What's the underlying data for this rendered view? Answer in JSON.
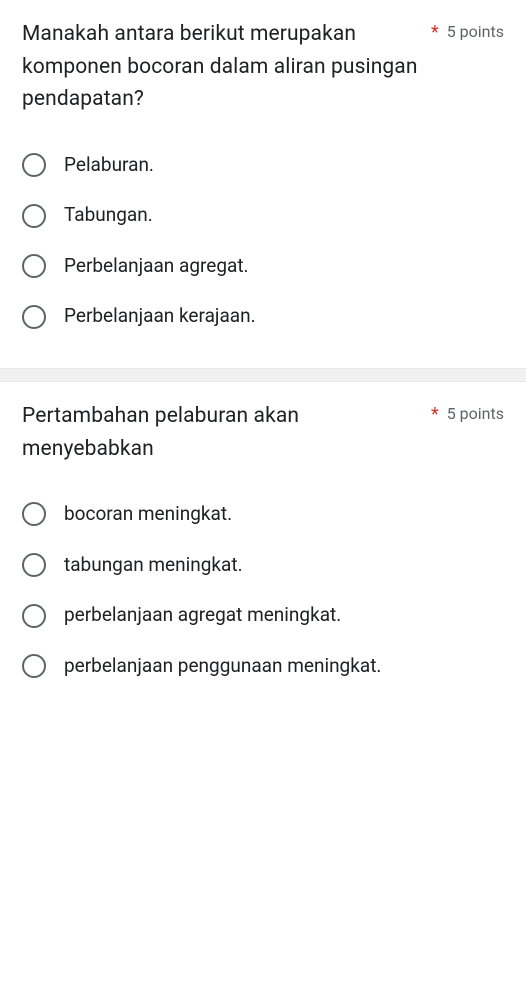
{
  "questions": [
    {
      "text": "Manakah antara berikut merupakan komponen bocoran dalam aliran pusingan pendapatan?",
      "required_marker": "*",
      "points": "5 points",
      "options": [
        "Pelaburan.",
        "Tabungan.",
        "Perbelanjaan agregat.",
        "Perbelanjaan kerajaan."
      ]
    },
    {
      "text": "Pertambahan pelaburan akan menyebabkan",
      "required_marker": "*",
      "points": "5 points",
      "options": [
        "bocoran meningkat.",
        "tabungan meningkat.",
        "perbelanjaan agregat meningkat.",
        "perbelanjaan penggunaan meningkat."
      ]
    }
  ]
}
